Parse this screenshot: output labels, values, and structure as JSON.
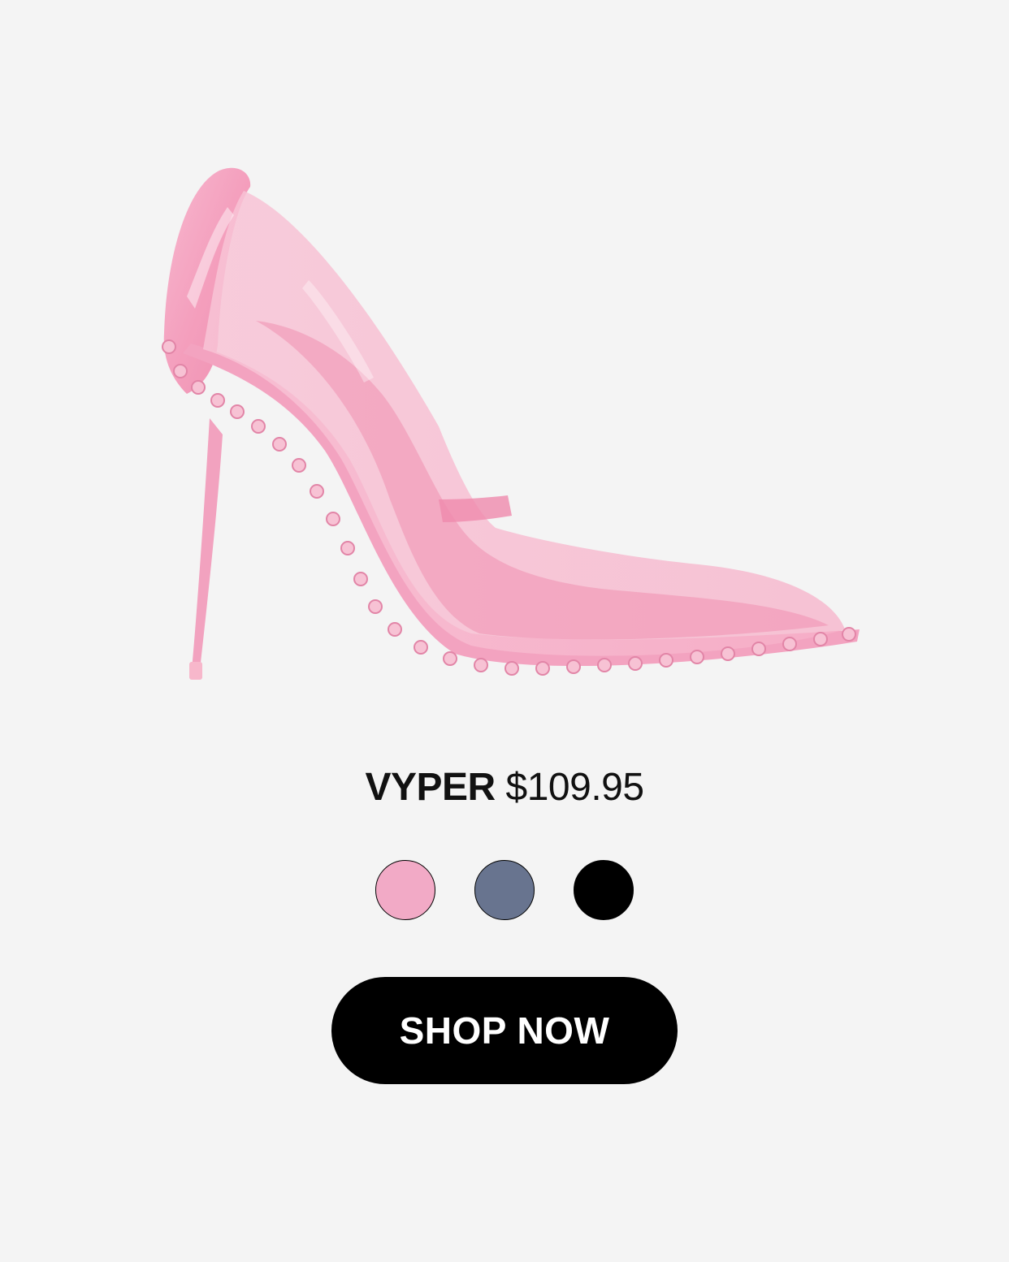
{
  "product": {
    "name": "VYPER",
    "price": "$109.95",
    "image_icon": "pink-pump-heel-image"
  },
  "swatches": [
    {
      "name": "pink",
      "color": "#f2aac6"
    },
    {
      "name": "blue-gray",
      "color": "#68748f"
    },
    {
      "name": "black",
      "color": "#000000"
    }
  ],
  "cta": {
    "label": "SHOP NOW"
  },
  "colors": {
    "background": "#f4f4f4",
    "button_bg": "#000000",
    "button_text": "#ffffff",
    "shoe_pink": "#f4a7c3"
  }
}
